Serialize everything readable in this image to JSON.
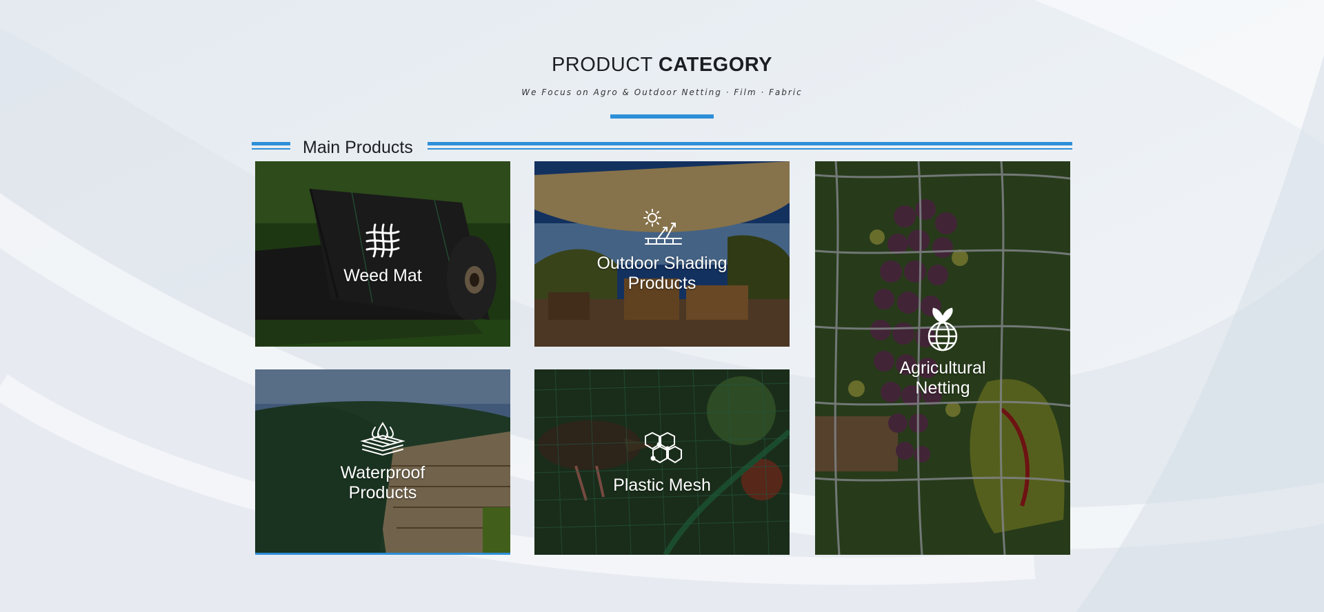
{
  "heading": {
    "light": "PRODUCT ",
    "bold": "CATEGORY"
  },
  "subtitle": "We Focus on Agro & Outdoor Netting · Film · Fabric",
  "section": {
    "title": "Main Products"
  },
  "colors": {
    "accent": "#2d8fd8",
    "background": "#eef2f6"
  },
  "products": [
    {
      "label": "Weed Mat",
      "icon": "mesh-grid-icon"
    },
    {
      "label": "Outdoor Shading Products",
      "icon": "sun-shade-icon"
    },
    {
      "label": "Agricultural Netting",
      "icon": "leaf-globe-icon"
    },
    {
      "label": "Waterproof Products",
      "icon": "water-drops-icon"
    },
    {
      "label": "Plastic Mesh",
      "icon": "hexagon-mesh-icon"
    }
  ]
}
